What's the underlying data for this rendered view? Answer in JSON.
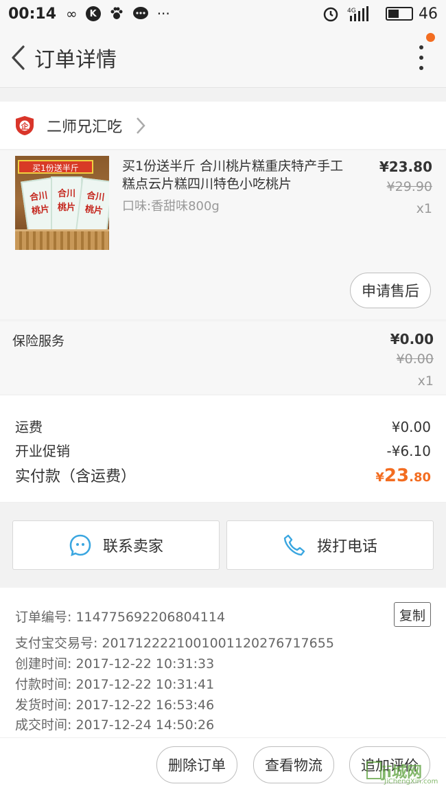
{
  "status_bar": {
    "time": "00:14",
    "battery": "46",
    "battery_level": 0.46,
    "network": "4G"
  },
  "header": {
    "title": "订单详情",
    "icons": [
      "back-arrow-icon",
      "more-vertical-icon"
    ],
    "notification_dot_color": "#f36d21"
  },
  "shop": {
    "name": "二师兄汇吃",
    "badge_icon": "enterprise-badge-icon",
    "badge_text": "企"
  },
  "product": {
    "title": "买1份送半斤 合川桃片糕重庆特产手工糕点云片糕四川特色小吃桃片",
    "spec": "口味:香甜味800g",
    "price": "¥23.80",
    "original_price": "¥29.90",
    "quantity": "x1",
    "image_banner": "买1份送半斤",
    "image_pack_text": "合川桃片",
    "after_sale_label": "申请售后"
  },
  "insurance": {
    "label": "保险服务",
    "price": "¥0.00",
    "original_price": "¥0.00",
    "quantity": "x1"
  },
  "summary": {
    "shipping_label": "运费",
    "shipping_value": "¥0.00",
    "promo_label": "开业促销",
    "promo_value": "-¥6.10",
    "paid_label": "实付款（含运费）",
    "paid_currency": "¥",
    "paid_int": "23",
    "paid_dec": ".80",
    "accent_color": "#f36d21"
  },
  "contact": {
    "seller_label": "联系卖家",
    "phone_label": "拨打电话",
    "icon_color": "#3aa6e0"
  },
  "order_info": {
    "order_no": "订单编号: 114775692206804114",
    "alipay_no": "支付宝交易号: 2017122221001001120276717655",
    "created": "创建时间: 2017-12-22 10:31:33",
    "paid": "付款时间: 2017-12-22 10:31:41",
    "shipped": "发货时间: 2017-12-22 16:53:46",
    "completed": "成交时间: 2017-12-24 14:50:26",
    "copy_label": "复制"
  },
  "bottom_bar": {
    "delete_label": "删除订单",
    "logistics_label": "查看物流",
    "review_label": "追加评价"
  },
  "watermark": {
    "main": "jī城网",
    "sub": "JiChengXin.com"
  }
}
